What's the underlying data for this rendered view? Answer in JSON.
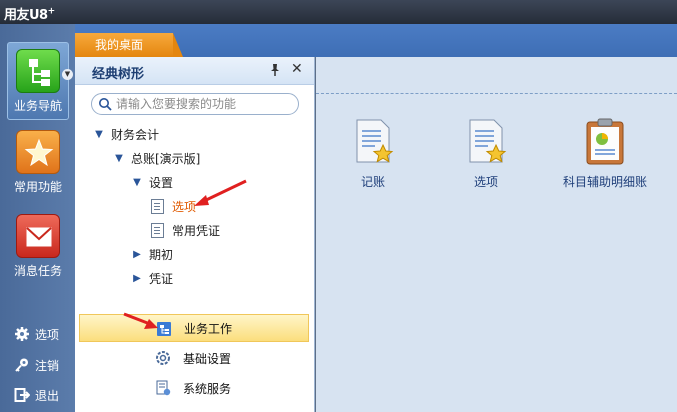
{
  "app": {
    "title": "用友U8",
    "title_sup": "+"
  },
  "rail": {
    "buttons": [
      {
        "label": "业务导航",
        "icon": "tree-nav-icon"
      },
      {
        "label": "常用功能",
        "icon": "star-icon"
      },
      {
        "label": "消息任务",
        "icon": "mail-icon"
      }
    ],
    "links": [
      {
        "label": "选项",
        "icon": "gear-icon"
      },
      {
        "label": "注销",
        "icon": "key-icon"
      },
      {
        "label": "退出",
        "icon": "exit-icon"
      }
    ]
  },
  "tabs": [
    {
      "label": "我的桌面"
    }
  ],
  "panel": {
    "title": "经典树形",
    "search_placeholder": "请输入您要搜索的功能",
    "tree": [
      {
        "label": "财务会计",
        "level": 0,
        "expanded": true
      },
      {
        "label": "总账[演示版]",
        "level": 1,
        "expanded": true
      },
      {
        "label": "设置",
        "level": 2,
        "expanded": true
      },
      {
        "label": "选项",
        "level": 3,
        "leaf": true,
        "selected": true
      },
      {
        "label": "常用凭证",
        "level": 3,
        "leaf": true
      },
      {
        "label": "期初",
        "level": 2,
        "expanded": false
      },
      {
        "label": "凭证",
        "level": 2,
        "expanded": false
      }
    ],
    "bottom_nav": [
      {
        "label": "业务工作",
        "icon": "business-work-icon",
        "active": true
      },
      {
        "label": "基础设置",
        "icon": "settings-gear-icon"
      },
      {
        "label": "系统服务",
        "icon": "system-service-icon"
      }
    ]
  },
  "desktop": {
    "icons": [
      {
        "label": "记账",
        "icon": "document-star-icon"
      },
      {
        "label": "选项",
        "icon": "document-star-icon"
      },
      {
        "label": "科目辅助明细账",
        "icon": "clipboard-chart-icon"
      }
    ]
  },
  "colors": {
    "accent_orange": "#e4860f",
    "selected_text": "#e05a00",
    "arrow_red": "#e02020"
  }
}
